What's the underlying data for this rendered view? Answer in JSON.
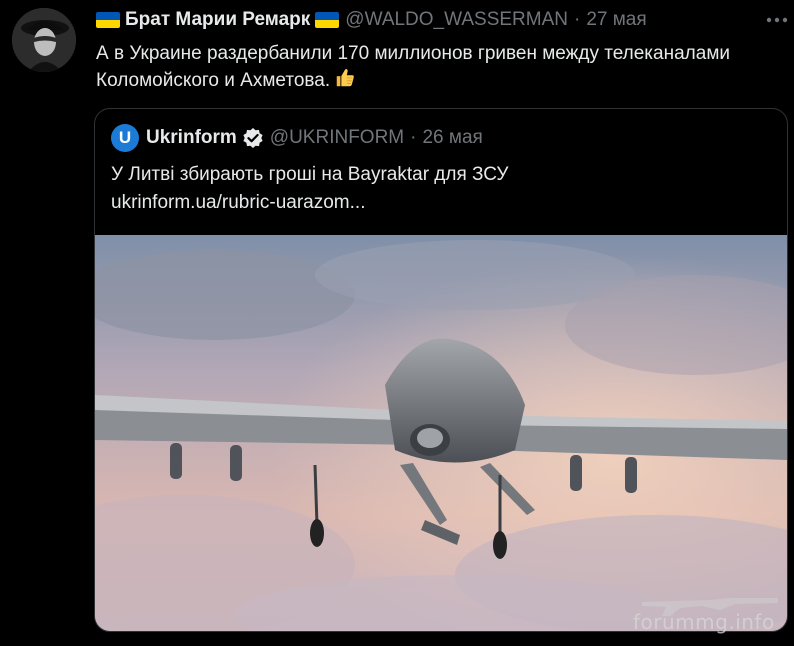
{
  "tweet": {
    "author_name": "Брат Марии Ремарк",
    "handle": "@WALDO_WASSERMAN",
    "separator": "·",
    "date": "27 мая",
    "more_icon": "ellipsis-icon",
    "text": "А в Украине раздербанили 170 миллионов гривен между телеканалами Коломойского и Ахметова.",
    "flag_colors": [
      "#0057b7",
      "#ffd700"
    ]
  },
  "quote": {
    "logo_letter": "U",
    "author_name": "Ukrinform",
    "handle": "@UKRINFORM",
    "separator": "·",
    "date": "26 мая",
    "text": "У Литві збирають гроші на Bayraktar для ЗСУ",
    "link": "ukrinform.ua/rubric-uarazom...",
    "image_icon": "drone-photo"
  },
  "watermark": {
    "text": "forummg.info"
  },
  "colors": {
    "background": "#000000",
    "text": "#e7e9ea",
    "muted": "#71767b",
    "border": "#2f3336",
    "brand_blue": "#1d7bd8"
  }
}
